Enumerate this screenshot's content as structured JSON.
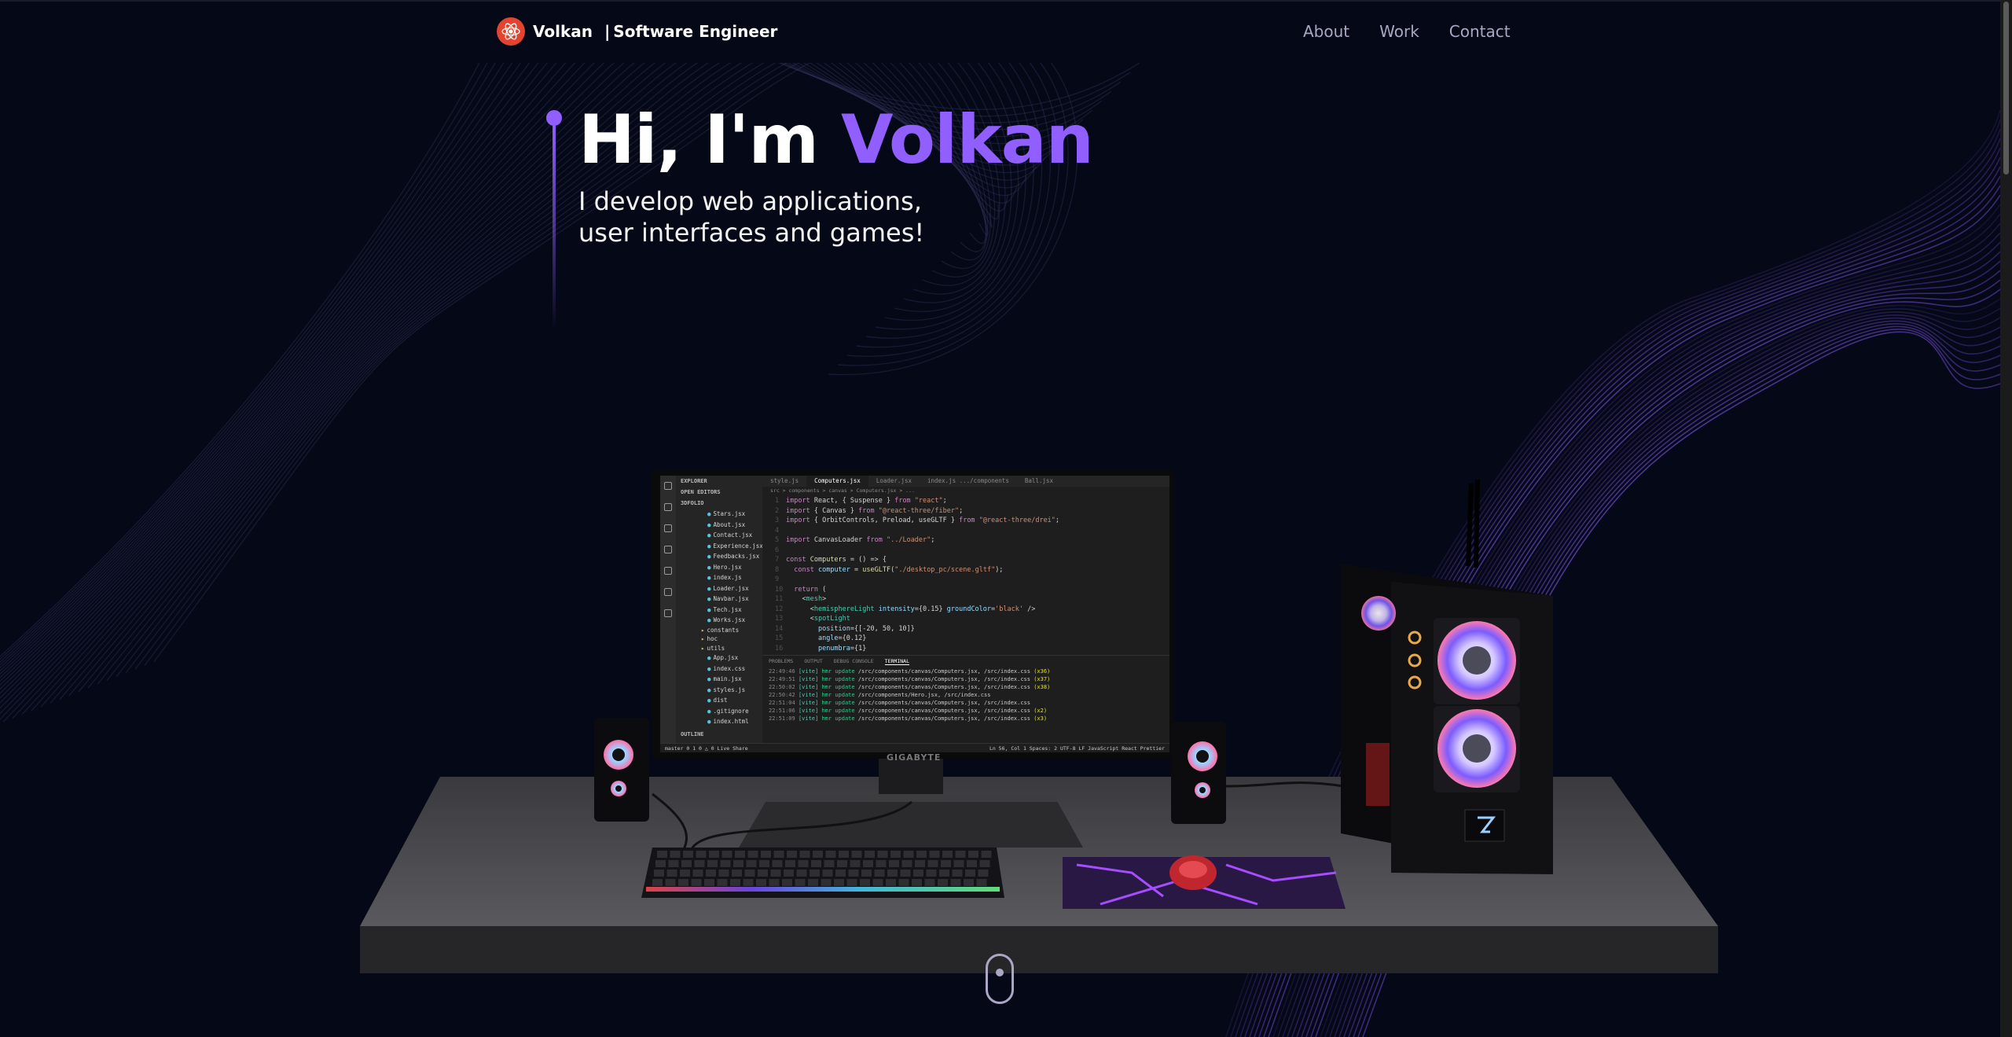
{
  "nav": {
    "brand_name": "Volkan",
    "brand_separator": "|",
    "brand_role": "Software Engineer",
    "links": [
      "About",
      "Work",
      "Contact"
    ]
  },
  "hero": {
    "greeting": "Hi, I'm",
    "name": "Volkan",
    "subtitle_line1": "I develop web applications,",
    "subtitle_line2": "user interfaces and games!"
  },
  "monitor": {
    "brand": "GIGABYTE",
    "explorer_title": "EXPLORER",
    "open_editors": "OPEN EDITORS",
    "project": "3DFOLIO",
    "files": [
      "Hero.jsx",
      "Stars.jsx",
      "About.jsx",
      "Contact.jsx",
      "Experience.jsx",
      "Feedbacks.jsx",
      "Hero.jsx",
      "index.js",
      "Loader.jsx",
      "Navbar.jsx",
      "Tech.jsx",
      "Works.jsx"
    ],
    "folders": [
      "constants",
      "hoc",
      "utils"
    ],
    "root_files": [
      "App.jsx",
      "index.css",
      "main.jsx",
      "styles.js"
    ],
    "other_files": [
      "dist",
      ".gitignore",
      "index.html"
    ],
    "outline": "OUTLINE",
    "tabs": [
      "style.js",
      "Computers.jsx",
      "Loader.jsx",
      "index.js .../components",
      "Ball.jsx"
    ],
    "breadcrumb": "src > components > canvas > Computers.jsx > ...",
    "panel_tabs": [
      "PROBLEMS",
      "OUTPUT",
      "DEBUG CONSOLE",
      "TERMINAL"
    ],
    "status_left": "master  0 1  0 △ 0  Live Share",
    "status_right": "Ln 56, Col 1  Spaces: 2  UTF-8  LF  JavaScript React  Prettier"
  },
  "colors": {
    "background": "#050816",
    "accent": "#915eff",
    "secondary_text": "#aaa6c3",
    "logo": "#e2442f"
  },
  "icons": [
    "atom-logo-icon",
    "mouse-scroll-icon"
  ]
}
